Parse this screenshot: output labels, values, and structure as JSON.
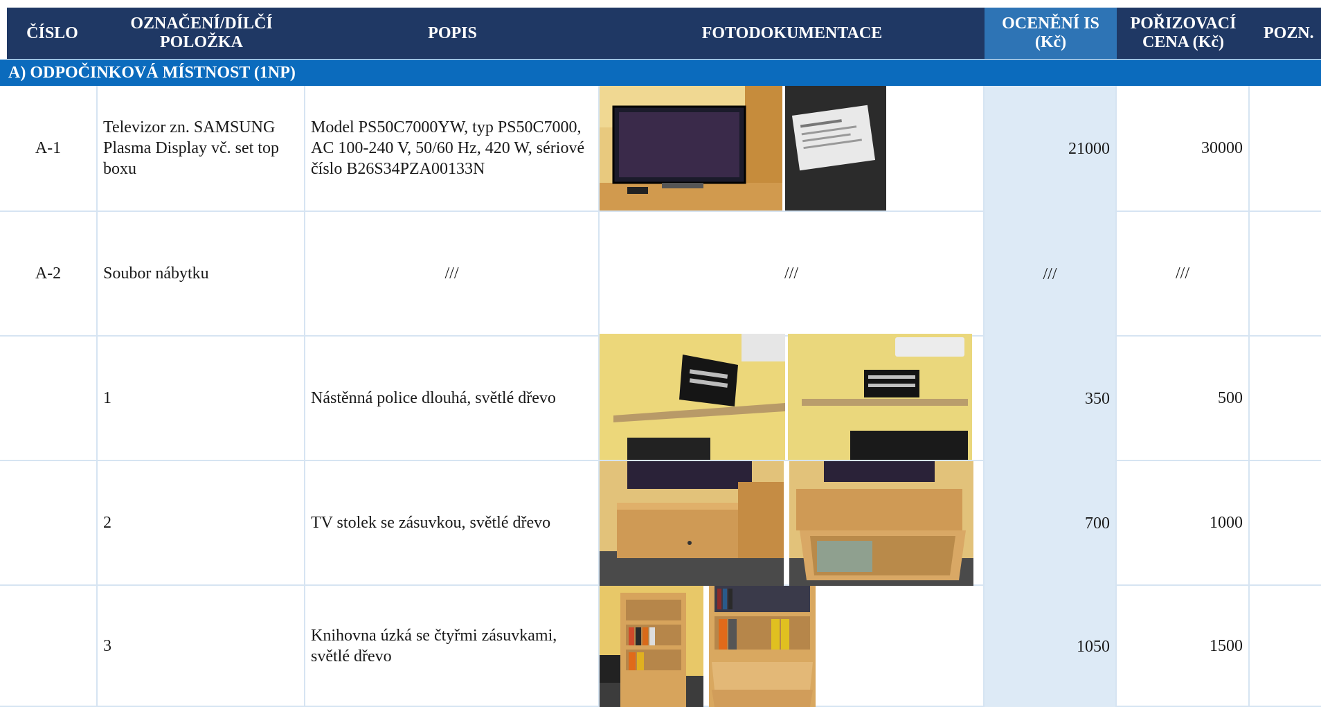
{
  "header": {
    "cislo": "ČÍSLO",
    "oznaceni": "OZNAČENÍ/DÍLČÍ POLOŽKA",
    "popis": "POPIS",
    "foto": "FOTODOKUMENTACE",
    "oceneni": "OCENĚNÍ IS (Kč)",
    "porizovaci": "POŘIZOVACÍ CENA (Kč)",
    "pozn": "POZN."
  },
  "section": {
    "title": "A) ODPOČINKOVÁ MÍSTNOST (1NP)"
  },
  "rows": [
    {
      "cislo": "A-1",
      "oznaceni": "Televizor zn. SAMSUNG Plasma Display vč. set top boxu",
      "popis": "Model PS50C7000YW, typ PS50C7000, AC 100-240 V, 50/60 Hz, 420 W, sériové číslo B26S34PZA00133N",
      "foto": "",
      "oceneni": "21000",
      "porizovaci": "30000",
      "pozn": ""
    },
    {
      "cislo": "A-2",
      "oznaceni": "Soubor nábytku",
      "popis": "///",
      "foto": "///",
      "oceneni": "///",
      "porizovaci": "///",
      "pozn": ""
    },
    {
      "cislo": "",
      "oznaceni": "1",
      "popis": "Nástěnná police dlouhá, světlé dřevo",
      "foto": "",
      "oceneni": "350",
      "porizovaci": "500",
      "pozn": ""
    },
    {
      "cislo": "",
      "oznaceni": "2",
      "popis": "TV stolek se zásuvkou, světlé dřevo",
      "foto": "",
      "oceneni": "700",
      "porizovaci": "1000",
      "pozn": ""
    },
    {
      "cislo": "",
      "oznaceni": "3",
      "popis": "Knihovna úzká se čtyřmi zásuvkami, světlé dřevo",
      "foto": "",
      "oceneni": "1050",
      "porizovaci": "1500",
      "pozn": ""
    }
  ],
  "colors": {
    "header_bg": "#1f3864",
    "header_highlight_bg": "#2e74b5",
    "section_bg": "#0b6bbd",
    "oceneni_column_bg": "#ddeaf6",
    "grid_line": "#d6e4f2"
  },
  "photos": {
    "row_a1": [
      "tv-photo",
      "tv-label-photo"
    ],
    "row_1": [
      "wall-shelf-photo",
      "wall-shelf-photo"
    ],
    "row_2": [
      "tv-stand-photo",
      "tv-stand-open-drawer-photo"
    ],
    "row_3": [
      "bookcase-photo",
      "bookcase-drawers-photo"
    ]
  }
}
